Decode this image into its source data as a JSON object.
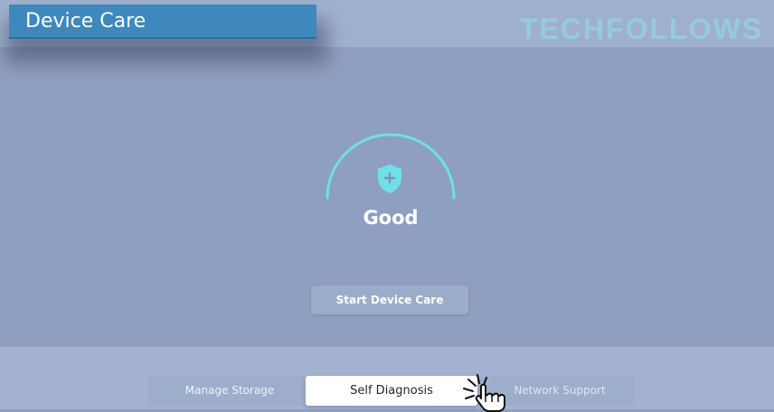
{
  "header": {
    "title": "Device Care",
    "watermark": "TECHFOLLOWS"
  },
  "status": {
    "label": "Good",
    "icon": "shield-plus-icon"
  },
  "actions": {
    "start_label": "Start Device Care"
  },
  "bottom_tabs": [
    {
      "label": "Manage Storage",
      "selected": false
    },
    {
      "label": "Self Diagnosis",
      "selected": true
    },
    {
      "label": "Network Support",
      "selected": false
    }
  ],
  "colors": {
    "accent": "#6fe0e8",
    "title_bg": "#3f88bd",
    "background": "#8f9fc1"
  }
}
